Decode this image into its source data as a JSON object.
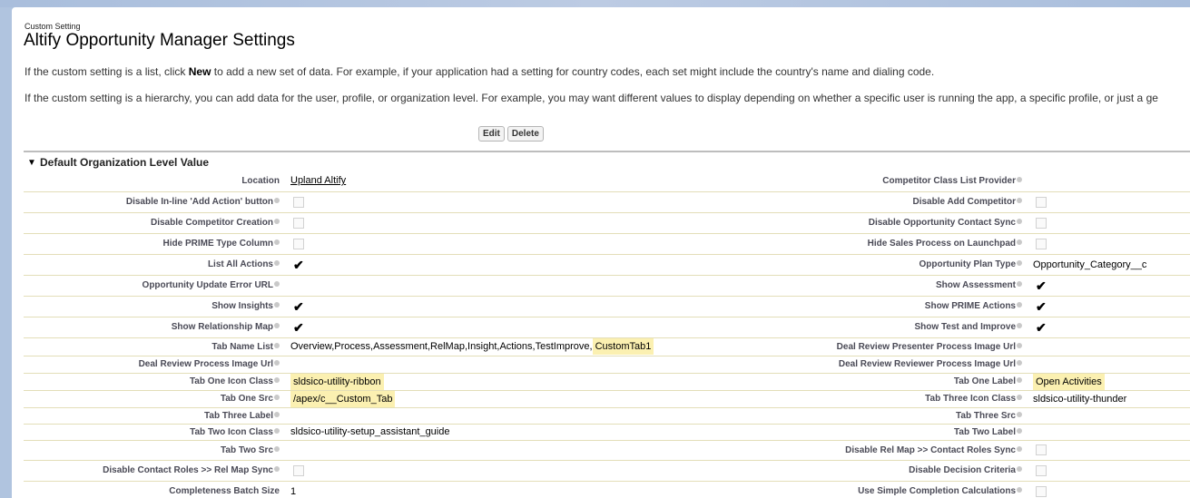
{
  "header": {
    "eyebrow": "Custom Setting",
    "title": "Altify Opportunity Manager Settings"
  },
  "intro": {
    "list_text_before": "If the custom setting is a list, click ",
    "list_text_bold": "New",
    "list_text_after": " to add a new set of data. For example, if your application had a setting for country codes, each set might include the country's name and dialing code.",
    "hierarchy_text": "If the custom setting is a hierarchy, you can add data for the user, profile, or organization level. For example, you may want different values to display depending on whether a specific user is running the app, a specific profile, or just a ge"
  },
  "buttons": {
    "edit": "Edit",
    "delete": "Delete"
  },
  "section": {
    "title": "Default Organization Level Value"
  },
  "fields": {
    "r0": {
      "l1": "Location",
      "v1": "Upland Altify",
      "l2": "Competitor Class List Provider",
      "v2": ""
    },
    "r1": {
      "l1": "Disable In-line 'Add Action' button",
      "l2": "Disable Add Competitor"
    },
    "r2": {
      "l1": "Disable Competitor Creation",
      "l2": "Disable Opportunity Contact Sync"
    },
    "r3": {
      "l1": "Hide PRIME Type Column",
      "l2": "Hide Sales Process on Launchpad"
    },
    "r4": {
      "l1": "List All Actions",
      "l2": "Opportunity Plan Type",
      "v2": "Opportunity_Category__c"
    },
    "r5": {
      "l1": "Opportunity Update Error URL",
      "v1": "",
      "l2": "Show Assessment"
    },
    "r6": {
      "l1": "Show Insights",
      "l2": "Show PRIME Actions"
    },
    "r7": {
      "l1": "Show Relationship Map",
      "l2": "Show Test and Improve"
    },
    "r8": {
      "l1": "Tab Name List",
      "v1a": "Overview,Process,Assessment,RelMap,Insight,Actions,TestImprove,",
      "v1b": "CustomTab1",
      "l2": "Deal Review Presenter Process Image Url",
      "v2": ""
    },
    "r9": {
      "l1": "Deal Review Process Image Url",
      "v1": "",
      "l2": "Deal Review Reviewer Process Image Url",
      "v2": ""
    },
    "r10": {
      "l1": "Tab One Icon Class",
      "v1": "sldsico-utility-ribbon",
      "l2": "Tab One Label",
      "v2": "Open Activities"
    },
    "r11": {
      "l1": "Tab One Src",
      "v1": "/apex/c__Custom_Tab",
      "l2": "Tab Three Icon Class",
      "v2": "sldsico-utility-thunder"
    },
    "r12": {
      "l1": "Tab Three Label",
      "v1": "",
      "l2": "Tab Three Src",
      "v2": ""
    },
    "r13": {
      "l1": "Tab Two Icon Class",
      "v1": "sldsico-utility-setup_assistant_guide",
      "l2": "Tab Two Label",
      "v2": ""
    },
    "r14": {
      "l1": "Tab Two Src",
      "v1": "",
      "l2": "Disable Rel Map >> Contact Roles Sync"
    },
    "r15": {
      "l1": "Disable Contact Roles >> Rel Map Sync",
      "l2": "Disable Decision Criteria"
    },
    "r16": {
      "l1": "Completeness Batch Size",
      "v1": "1",
      "l2": "Use Simple Completion Calculations"
    }
  },
  "icons": {
    "section_toggle": "▼",
    "checkmark": "✔"
  }
}
